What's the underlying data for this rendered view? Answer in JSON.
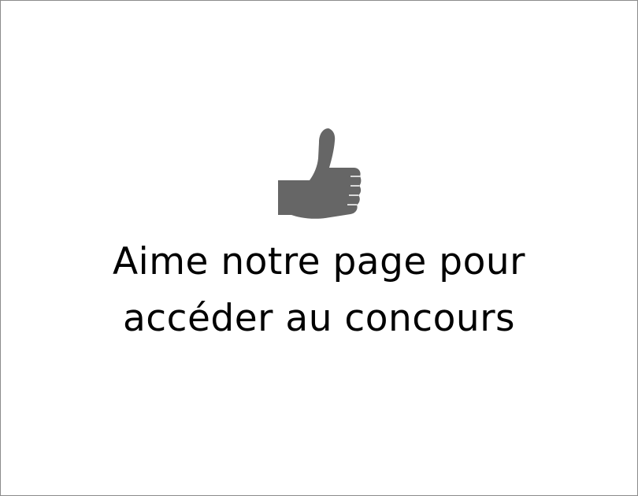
{
  "like_gate": {
    "icon": "thumbs-up-icon",
    "icon_color": "#666666",
    "text_color": "#000000",
    "background_color": "#ffffff",
    "message_line_1": "Aime notre page pour",
    "message_line_2": "accéder au concours"
  }
}
